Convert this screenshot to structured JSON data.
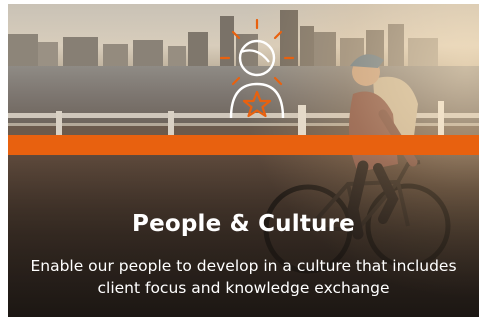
{
  "card": {
    "title": "People & Culture",
    "description": "Enable our people to develop in a culture that includes client focus and knowledge exchange"
  },
  "emblem": {
    "icon": "person-with-star-icon",
    "color": "#ffffff",
    "accent_color": "#e8610f"
  },
  "colors": {
    "accent": "#e8610f",
    "text": "#ffffff"
  }
}
